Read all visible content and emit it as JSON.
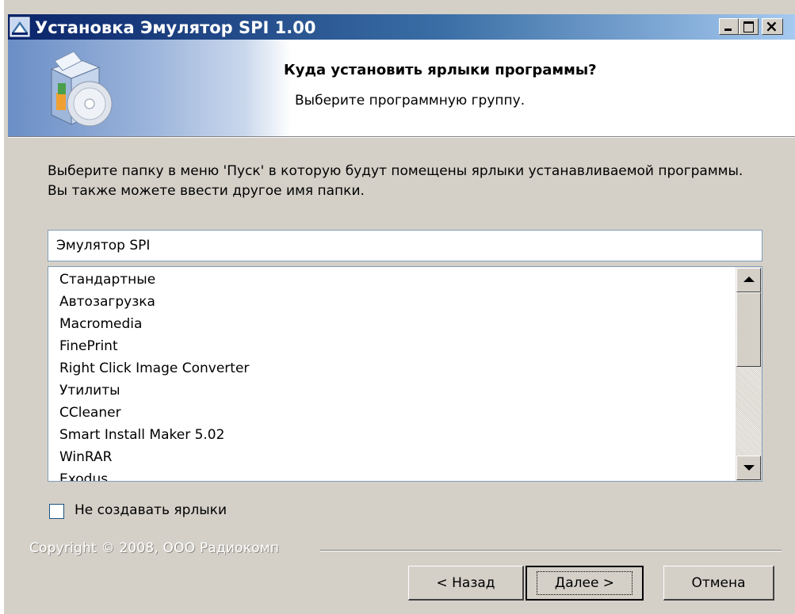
{
  "window": {
    "title": "Установка Эмулятор SPI 1.00",
    "controls": [
      "minimize-icon",
      "maximize-icon",
      "close-icon"
    ]
  },
  "header": {
    "title": "Куда установить ярлыки программы?",
    "subtitle": "Выберите программную группу.",
    "icon": "installer-box-cd-icon"
  },
  "body": {
    "description": "Выберите папку в меню 'Пуск' в которую будут помещены ярлыки устанавливаемой программы. Вы также можете ввести другое имя папки.",
    "folder_input_value": "Эмулятор SPI",
    "folder_list": [
      "Стандартные",
      "Автозагрузка",
      "Macromedia",
      "FinePrint",
      "Right Click Image Converter",
      "Утилиты",
      "CCleaner",
      "Smart Install Maker 5.02",
      "WinRAR",
      "Exodus"
    ],
    "no_shortcuts_label": "Не создавать ярлыки",
    "no_shortcuts_checked": false
  },
  "footer": {
    "copyright": "Copyright © 2008, ООО Радиокомп",
    "back_label": "< Назад",
    "next_label": "Далее >",
    "cancel_label": "Отмена"
  },
  "colors": {
    "title_bar_start": "#0a246a",
    "title_bar_end": "#a6caf0",
    "dialog_background": "#d4d0c8"
  }
}
